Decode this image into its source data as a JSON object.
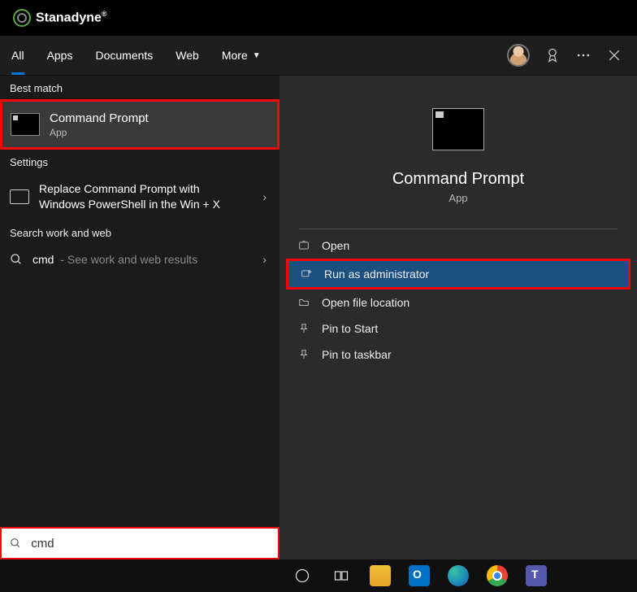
{
  "brand": {
    "name": "Stanadyne"
  },
  "filter_tabs": {
    "all": "All",
    "apps": "Apps",
    "documents": "Documents",
    "web": "Web",
    "more": "More"
  },
  "sections": {
    "best_match": "Best match",
    "settings": "Settings",
    "search_web": "Search work and web"
  },
  "best_match": {
    "title": "Command Prompt",
    "subtitle": "App"
  },
  "settings_item": {
    "text": "Replace Command Prompt with Windows PowerShell in the Win + X"
  },
  "web_result": {
    "query": "cmd",
    "suffix": "- See work and web results"
  },
  "detail": {
    "title": "Command Prompt",
    "subtitle": "App"
  },
  "actions": {
    "open": "Open",
    "run_as_admin": "Run as administrator",
    "open_location": "Open file location",
    "pin_start": "Pin to Start",
    "pin_taskbar": "Pin to taskbar"
  },
  "search": {
    "value": "cmd"
  },
  "taskbar": {
    "apps": [
      "cortana",
      "task-view",
      "file-explorer",
      "outlook",
      "edge",
      "chrome",
      "teams"
    ]
  }
}
